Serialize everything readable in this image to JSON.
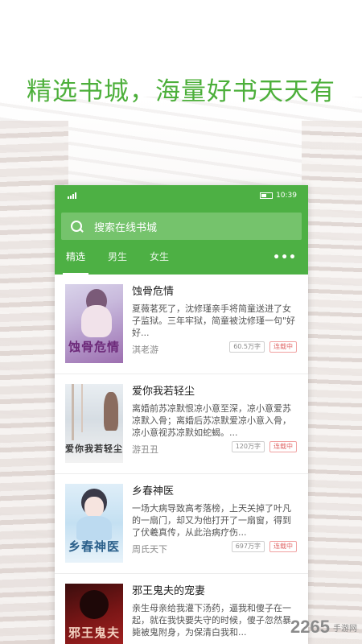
{
  "headline": "精选书城，海量好书天天有",
  "status": {
    "time": "10:39"
  },
  "search": {
    "placeholder": "搜索在线书城"
  },
  "tabs": [
    {
      "label": "精选",
      "active": true
    },
    {
      "label": "男生",
      "active": false
    },
    {
      "label": "女生",
      "active": false
    }
  ],
  "books": [
    {
      "title": "蚀骨危情",
      "desc": "夏薇茗死了，沈修瑾亲手将简童送进了女子监狱。三年牢狱，简童被沈修瑾一句\"好好...",
      "author": "淇老游",
      "words": "60.5万字",
      "status": "连载中",
      "cover_text": "蚀骨危情"
    },
    {
      "title": "爱你我若轻尘",
      "desc": "离婚前苏凉默恨凉小意至深，凉小意爱苏凉默入骨；离婚后苏凉默爱凉小意入骨，凉小意视苏凉默如蛇蝎。...",
      "author": "游丑丑",
      "words": "120万字",
      "status": "连载中",
      "cover_text": "爱你我若轻尘"
    },
    {
      "title": "乡春神医",
      "desc": "一场大病导致高考落榜，上天关掉了叶凡的一扇门，却又为他打开了一扇窗，得到了伏羲真传，从此治病疗伤...",
      "author": "周氏天下",
      "words": "697万字",
      "status": "连载中",
      "cover_text": "乡春神医"
    },
    {
      "title": "邪王鬼夫的宠妻",
      "desc": "亲生母亲给我灌下汤药，逼我和傻子在一起，就在我快要失守的时候，傻子忽然暴毙被鬼附身，为保清白我和...",
      "author": "",
      "words": "",
      "status": "",
      "cover_text": "邪王鬼夫"
    }
  ],
  "watermark": {
    "brand": "2265",
    "sub": "手游网"
  },
  "colors": {
    "accent": "#4db044",
    "headline": "#4caf3a",
    "status_badge": "#e06666"
  }
}
